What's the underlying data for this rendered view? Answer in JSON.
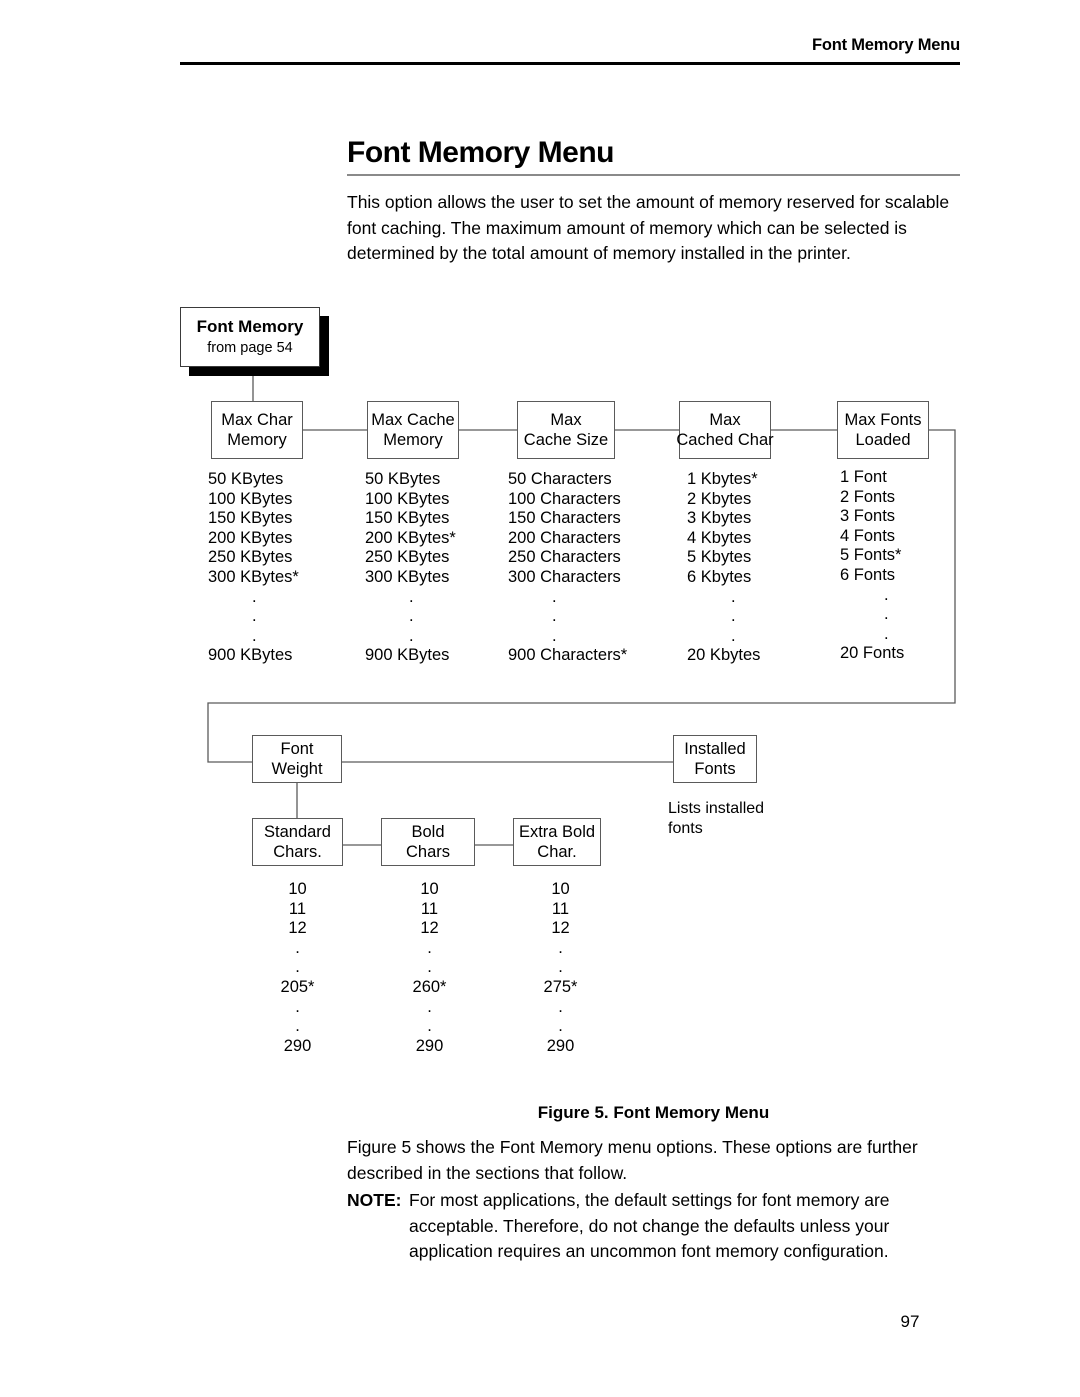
{
  "running_header": "Font Memory Menu",
  "page_title": "Font Memory Menu",
  "intro_paragraph": "This option allows the user to set the amount of memory reserved for scalable font caching. The maximum amount of memory which can be selected is determined by the total amount of memory installed in the printer.",
  "figure": {
    "root": {
      "title": "Font Memory",
      "subtitle": "from page 54"
    },
    "row1": [
      {
        "line1": "Max Char",
        "line2": "Memory"
      },
      {
        "line1": "Max Cache",
        "line2": "Memory"
      },
      {
        "line1": "Max",
        "line2": "Cache Size"
      },
      {
        "line1": "Max",
        "line2": "Cached Char"
      },
      {
        "line1": "Max Fonts",
        "line2": "Loaded"
      }
    ],
    "row1_values": [
      [
        "50 KBytes",
        "100 KBytes",
        "150 KBytes",
        "200 KBytes",
        "250 KBytes",
        "300 KBytes*",
        ".",
        ".",
        ".",
        "900 KBytes"
      ],
      [
        "50 KBytes",
        "100 KBytes",
        "150 KBytes",
        "200 KBytes*",
        "250 KBytes",
        "300 KBytes",
        ".",
        ".",
        ".",
        "900 KBytes"
      ],
      [
        "50 Characters",
        "100 Characters",
        "150 Characters",
        "200 Characters",
        "250 Characters",
        "300 Characters",
        ".",
        ".",
        ".",
        "900 Characters*"
      ],
      [
        "1 Kbytes*",
        "2 Kbytes",
        "3 Kbytes",
        "4 Kbytes",
        "5 Kbytes",
        "6 Kbytes",
        ".",
        ".",
        ".",
        "20 Kbytes"
      ],
      [
        "1 Font",
        "2 Fonts",
        "3 Fonts",
        "4 Fonts",
        "5 Fonts*",
        "6 Fonts",
        ".",
        ".",
        ".",
        "20 Fonts"
      ]
    ],
    "row2": [
      {
        "line1": "Font",
        "line2": "Weight"
      },
      {
        "line1": "Installed",
        "line2": "Fonts"
      }
    ],
    "installed_fonts_note": "Lists installed fonts",
    "row3": [
      {
        "line1": "Standard",
        "line2": "Chars."
      },
      {
        "line1": "Bold",
        "line2": "Chars"
      },
      {
        "line1": "Extra Bold",
        "line2": "Char."
      }
    ],
    "row3_values": [
      [
        "10",
        "11",
        "12",
        ".",
        ".",
        "205*",
        ".",
        ".",
        "290"
      ],
      [
        "10",
        "11",
        "12",
        ".",
        ".",
        "260*",
        ".",
        ".",
        "290"
      ],
      [
        "10",
        "11",
        "12",
        ".",
        ".",
        "275*",
        ".",
        ".",
        "290"
      ]
    ],
    "caption": "Figure 5. Font Memory Menu"
  },
  "closing_paragraph": "Figure 5 shows the Font Memory menu options. These options are further described in the sections that follow.",
  "note": {
    "label": "NOTE:",
    "body": "For most applications, the default settings for font memory are acceptable. Therefore, do not change the defaults unless your application requires an uncommon font memory configuration."
  },
  "page_number": "97"
}
